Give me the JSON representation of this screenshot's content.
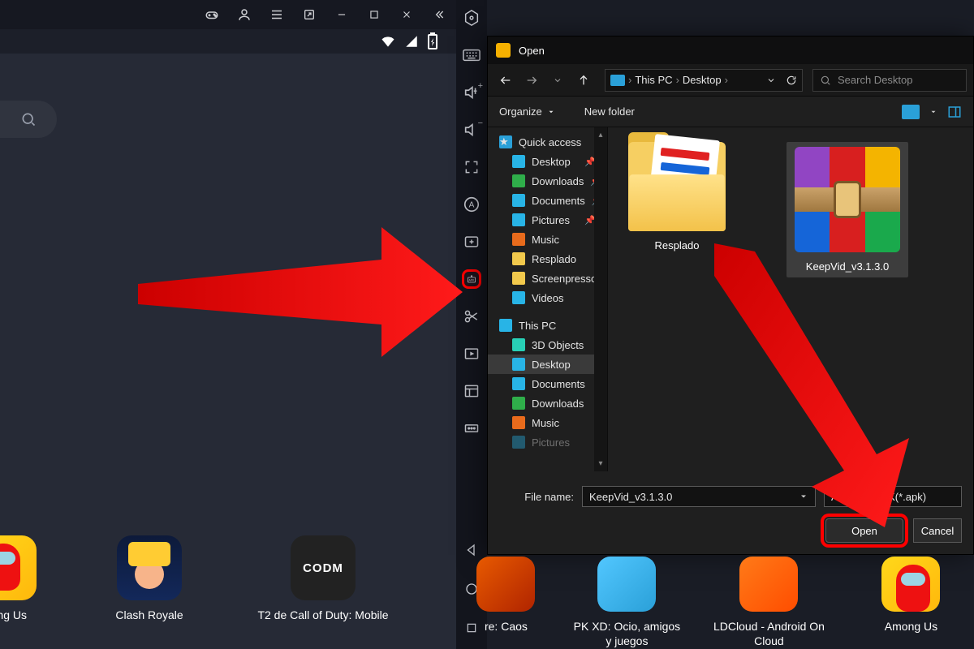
{
  "emulator": {
    "titlebar_icons": [
      "gamepad",
      "profile",
      "menu",
      "popout",
      "minimize",
      "maximize",
      "close",
      "collapse"
    ],
    "status_icons": [
      "wifi",
      "signal",
      "battery"
    ],
    "search_placeholder": "",
    "home_apps": [
      {
        "label": "mong Us",
        "icon": "among"
      },
      {
        "label": "Clash Royale",
        "icon": "clash"
      },
      {
        "label": "T2 de Call of Duty: Mobile",
        "icon": "cod"
      }
    ]
  },
  "rail": {
    "items": [
      "settings-hex",
      "keyboard",
      "volume-up",
      "volume-down",
      "fullscreen",
      "rotate-text",
      "add-window",
      "install-apk",
      "scissors",
      "play-frame",
      "layout",
      "more"
    ],
    "highlighted": "install-apk",
    "nav": [
      "back-triangle",
      "home-circle",
      "recent-square"
    ]
  },
  "dialog": {
    "title": "Open",
    "breadcrumb": {
      "root": "This PC",
      "folder": "Desktop"
    },
    "search_placeholder": "Search Desktop",
    "toolbar": {
      "organize": "Organize",
      "newfolder": "New folder"
    },
    "tree": {
      "quick": "Quick access",
      "quick_items": [
        {
          "label": "Desktop",
          "icon": "desk",
          "pin": true
        },
        {
          "label": "Downloads",
          "icon": "dl",
          "pin": true
        },
        {
          "label": "Documents",
          "icon": "doc",
          "pin": true
        },
        {
          "label": "Pictures",
          "icon": "pic",
          "pin": true
        },
        {
          "label": "Music",
          "icon": "mus",
          "pin": false
        },
        {
          "label": "Resplado",
          "icon": "fol",
          "pin": false
        },
        {
          "label": "Screenpresso",
          "icon": "fol",
          "pin": false
        },
        {
          "label": "Videos",
          "icon": "vid",
          "pin": false
        }
      ],
      "thispc": "This PC",
      "pc_items": [
        {
          "label": "3D Objects",
          "icon": "obj"
        },
        {
          "label": "Desktop",
          "icon": "desk",
          "selected": true
        },
        {
          "label": "Documents",
          "icon": "doc"
        },
        {
          "label": "Downloads",
          "icon": "dl"
        },
        {
          "label": "Music",
          "icon": "mus"
        },
        {
          "label": "Pictures",
          "icon": "pic"
        }
      ]
    },
    "files": [
      {
        "label": "Resplado",
        "kind": "folder"
      },
      {
        "label": "KeepVid_v3.1.3.0",
        "kind": "rar",
        "selected": true
      }
    ],
    "filename_label": "File name:",
    "filename_value": "KeepVid_v3.1.3.0",
    "filter_value": "Archivos APK(*.apk)",
    "open_label": "Open",
    "cancel_label": "Cancel"
  },
  "strip_apps": [
    {
      "label": "re: Caos",
      "icon": "ff"
    },
    {
      "label": "PK XD: Ocio, amigos y juegos",
      "icon": "pkxd"
    },
    {
      "label": "LDCloud - Android On Cloud",
      "icon": "ldc"
    },
    {
      "label": "Among Us",
      "icon": "among"
    }
  ],
  "colors": {
    "highlight": "#ff0000"
  }
}
